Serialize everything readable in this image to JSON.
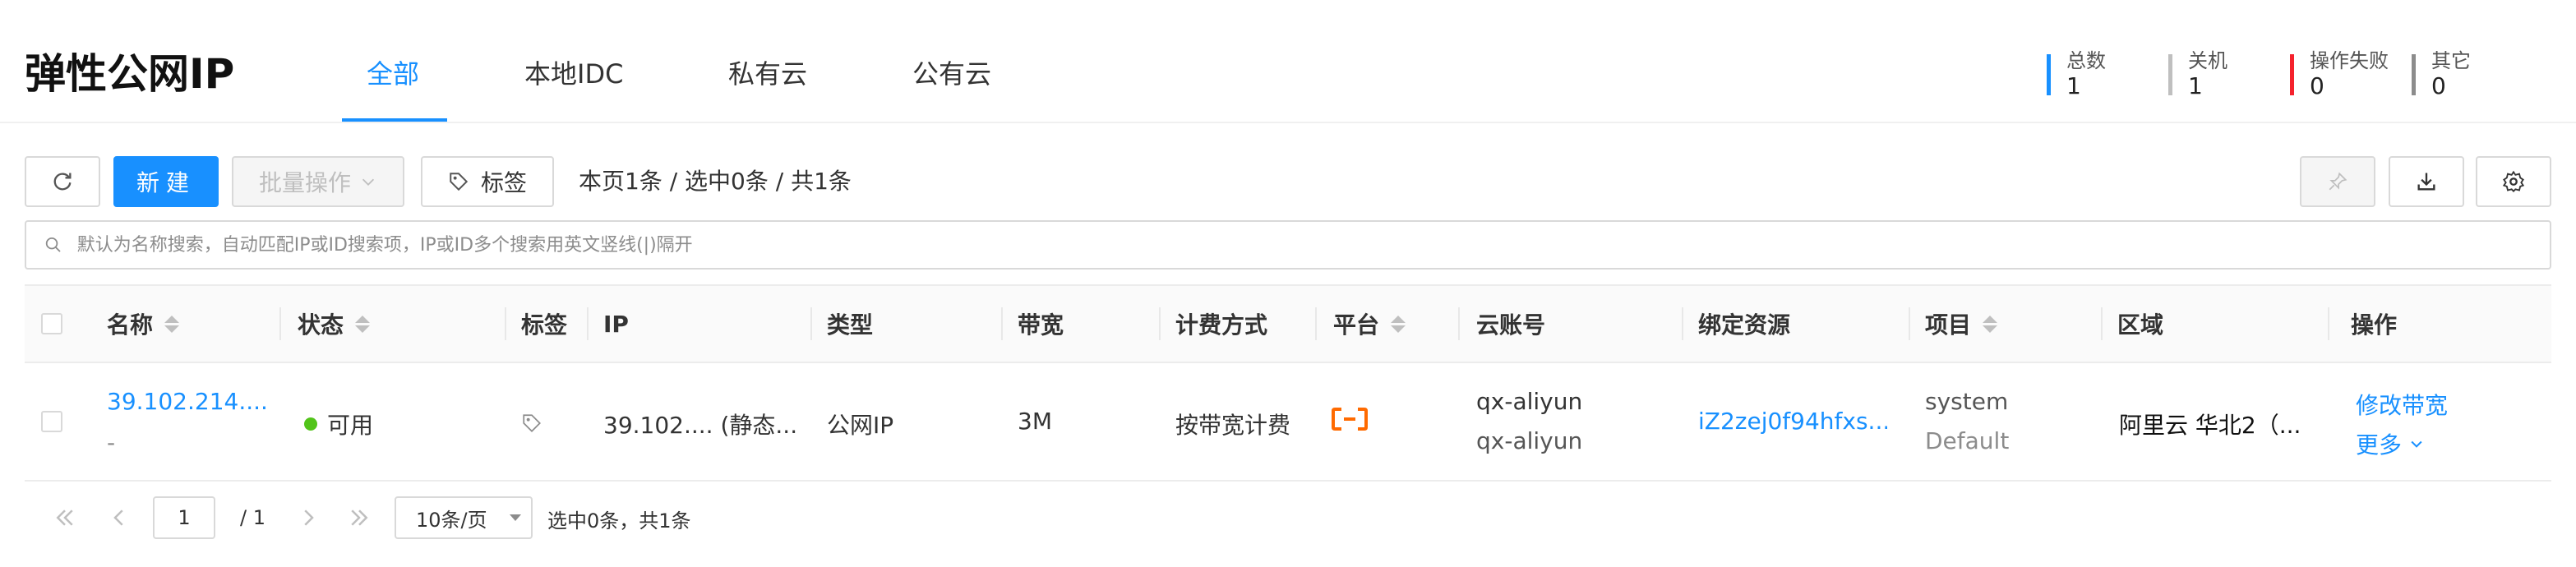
{
  "page": {
    "title": "弹性公网IP"
  },
  "tabs": [
    {
      "label": "全部",
      "active": true
    },
    {
      "label": "本地IDC",
      "active": false
    },
    {
      "label": "私有云",
      "active": false
    },
    {
      "label": "公有云",
      "active": false
    }
  ],
  "stats": [
    {
      "label": "总数",
      "value": "1",
      "color": "#1890ff"
    },
    {
      "label": "关机",
      "value": "1",
      "color": "#bfbfbf"
    },
    {
      "label": "操作失败",
      "value": "0",
      "color": "#f5222d"
    },
    {
      "label": "其它",
      "value": "0",
      "color": "#8c8c8c"
    }
  ],
  "toolbar": {
    "new_label": "新建",
    "batch_label": "批量操作",
    "tag_label": "标签",
    "count_text": "本页1条 / 选中0条 / 共1条"
  },
  "search": {
    "placeholder": "默认为名称搜索，自动匹配IP或ID搜索项，IP或ID多个搜索用英文竖线(|)隔开"
  },
  "table": {
    "columns": {
      "name": "名称",
      "status": "状态",
      "tags": "标签",
      "ip": "IP",
      "type": "类型",
      "bandwidth": "带宽",
      "billing": "计费方式",
      "platform": "平台",
      "account": "云账号",
      "bound": "绑定资源",
      "project": "项目",
      "region": "区域",
      "actions": "操作"
    },
    "rows": [
      {
        "name": "39.102.214....",
        "name_sub": "-",
        "status": "可用",
        "status_color": "#52c41a",
        "ip": "39.102.... (静态...",
        "type": "公网IP",
        "bandwidth": "3M",
        "billing": "按带宽计费",
        "platform_icon": "aliyun-icon",
        "platform_color": "#ff6a00",
        "account": "qx-aliyun",
        "account_sub": "qx-aliyun",
        "bound": "iZ2zej0f94hfxs...",
        "project": "system",
        "project_sub": "Default",
        "region": "阿里云 华北2（...",
        "action_primary": "修改带宽",
        "action_more": "更多"
      }
    ]
  },
  "pagination": {
    "current": "1",
    "total_pages": "/ 1",
    "page_size": "10条/页",
    "status": "选中0条，共1条"
  }
}
